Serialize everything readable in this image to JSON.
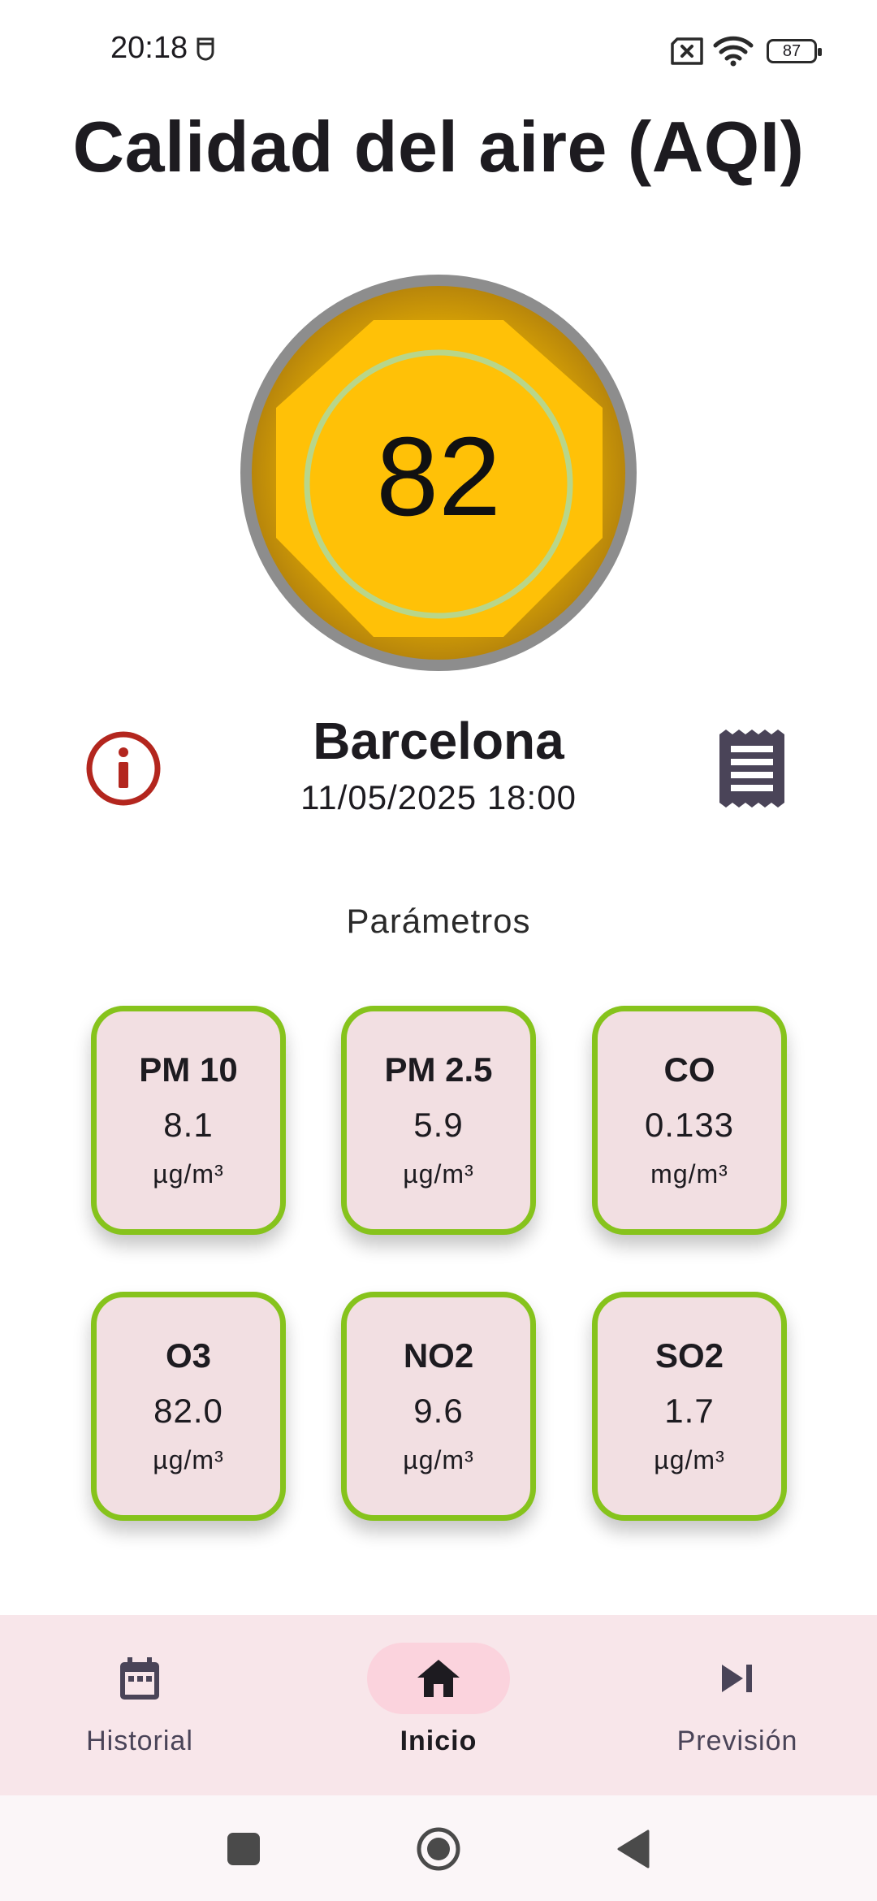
{
  "status_bar": {
    "time": "20:18",
    "battery": "87",
    "icons": [
      "face-notification-icon",
      "sim-off-icon",
      "wifi-icon",
      "battery-icon"
    ]
  },
  "header": {
    "title": "Calidad del aire (AQI)"
  },
  "aqi": {
    "value": "82",
    "level_fraction": 0.82,
    "colors": {
      "ring": "#8d8d8d",
      "fill": "#ffc107",
      "fill_dark": "#cc9a06",
      "inner_ring": "#b8d68a"
    }
  },
  "location": {
    "city": "Barcelona",
    "datetime": "11/05/2025 18:00",
    "info_icon": "info-icon",
    "receipt_icon": "receipt-icon"
  },
  "parameters": {
    "title": "Parámetros",
    "items": [
      {
        "name": "PM 10",
        "value": "8.1",
        "unit": "µg/m³"
      },
      {
        "name": "PM 2.5",
        "value": "5.9",
        "unit": "µg/m³"
      },
      {
        "name": "CO",
        "value": "0.133",
        "unit": "mg/m³"
      },
      {
        "name": "O3",
        "value": "82.0",
        "unit": "µg/m³"
      },
      {
        "name": "NO2",
        "value": "9.6",
        "unit": "µg/m³"
      },
      {
        "name": "SO2",
        "value": "1.7",
        "unit": "µg/m³"
      }
    ],
    "border_color": "#86c31c",
    "card_color": "#f2dfe2"
  },
  "bottom_nav": {
    "items": [
      {
        "label": "Historial",
        "icon": "calendar-icon",
        "active": false
      },
      {
        "label": "Inicio",
        "icon": "home-icon",
        "active": true
      },
      {
        "label": "Previsión",
        "icon": "skip-next-icon",
        "active": false
      }
    ]
  },
  "system_nav": {
    "icons": [
      "recents-icon",
      "home-circle-icon",
      "back-icon"
    ]
  }
}
